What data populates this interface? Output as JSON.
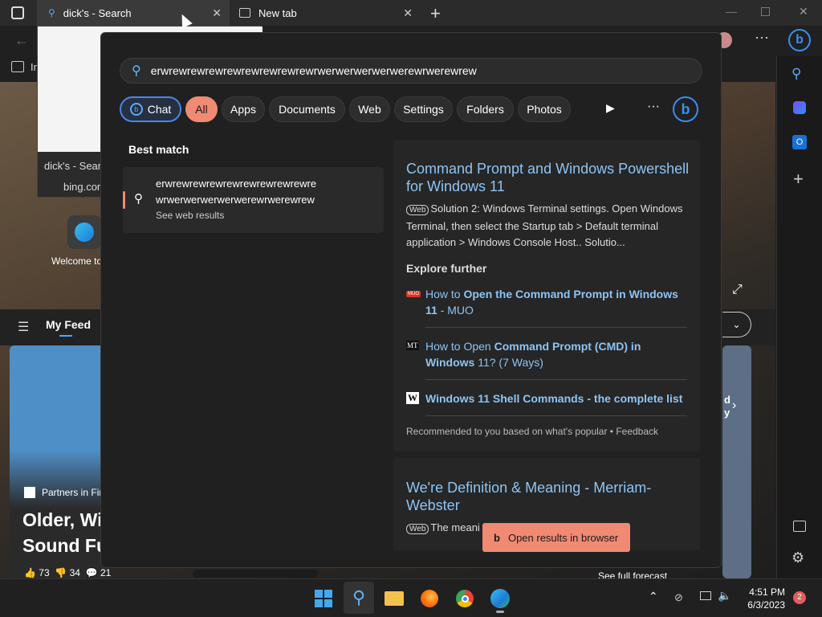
{
  "tabs": [
    {
      "title": "dick's - Search"
    },
    {
      "title": "New tab"
    }
  ],
  "preview": {
    "title": "dick's - Search",
    "url": "bing.com"
  },
  "background": {
    "favorites_partial": "In",
    "welcome_partial": "Welcome to",
    "feed_label": "My Feed",
    "partners": "Partners in Fin",
    "headline_l1": "Older, Wi",
    "headline_l2": "Sound Fu",
    "likes": "73",
    "dislikes": "34",
    "comments": "21",
    "right_partial_1": "d",
    "right_partial_2": "y",
    "forecast": "See full forecast"
  },
  "search": {
    "query": "erwrewrewrewrewrewrewrewrewrwerwerwerwerwerewrwerewrew"
  },
  "filters": [
    {
      "label": "Chat"
    },
    {
      "label": "All"
    },
    {
      "label": "Apps"
    },
    {
      "label": "Documents"
    },
    {
      "label": "Web"
    },
    {
      "label": "Settings"
    },
    {
      "label": "Folders"
    },
    {
      "label": "Photos"
    }
  ],
  "best_match": {
    "heading": "Best match",
    "line1": "erwrewrewrewrewrewrewrewrewre",
    "line2": "wrwerwerwerwerwerewrwerewrew",
    "sub": "See web results"
  },
  "result1": {
    "title": "Command Prompt and Windows Powershell for Windows 11",
    "web_badge": "Web",
    "snippet": "Solution 2: Windows Terminal settings. Open Windows Terminal, then select the Startup tab > Default terminal application > Windows Console Host.. Solutio...",
    "explore": "Explore further",
    "links": [
      {
        "icon": "MUO",
        "pre": "How to ",
        "bold": "Open the Command Prompt in Windows 11",
        "post": " - MUO"
      },
      {
        "icon": "MT",
        "pre": "How to Open ",
        "bold": "Command Prompt (CMD) in Windows",
        "post": " 11? (7 Ways)"
      },
      {
        "icon": "W",
        "pre": "",
        "bold": "Windows 11 Shell Commands - the complete list",
        "post": ""
      }
    ],
    "footer": "Recommended to you based on what's popular • Feedback"
  },
  "result2": {
    "title": "We're Definition & Meaning - Merriam-Webster",
    "web_badge": "Web",
    "snippet": "The meani"
  },
  "open_browser": "Open results in browser",
  "clock": {
    "time": "4:51 PM",
    "date": "6/3/2023"
  },
  "notif_count": "2",
  "colors": {
    "accent": "#f08a73",
    "link": "#8cc4f5",
    "panel": "#202020"
  }
}
